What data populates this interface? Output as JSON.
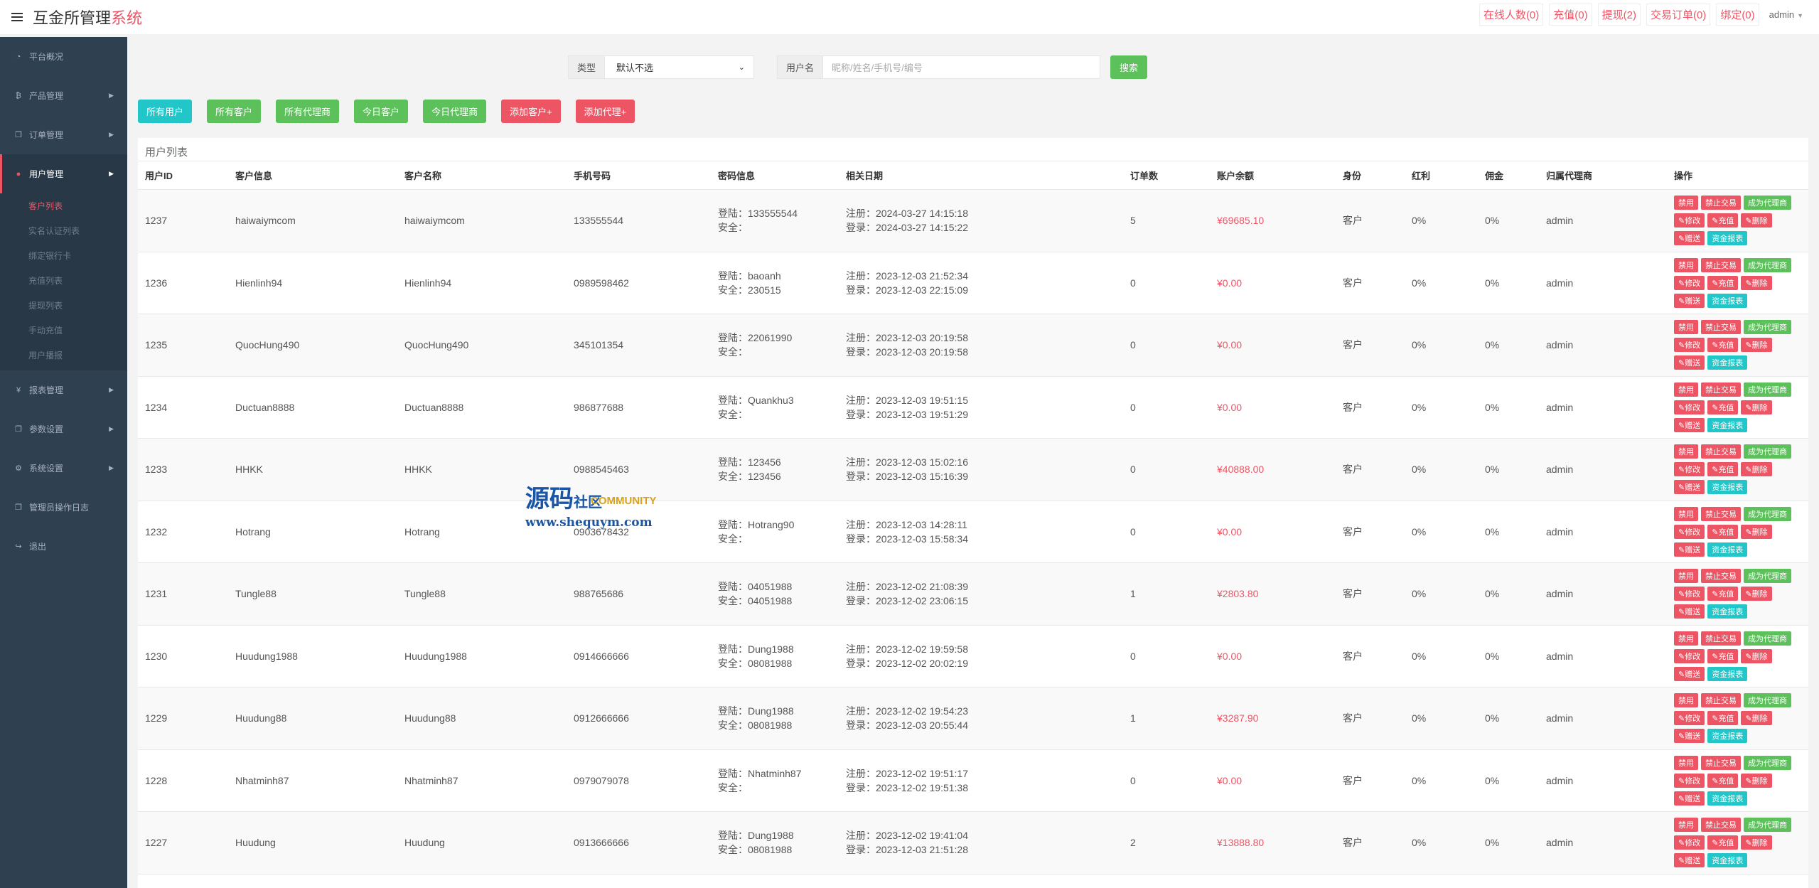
{
  "header": {
    "brand_main": "互金所管理",
    "brand_accent": "系统",
    "links": [
      "在线人数(0)",
      "充值(0)",
      "提现(2)",
      "交易订单(0)",
      "绑定(0)"
    ],
    "admin": "admin"
  },
  "sidebar": {
    "items": [
      {
        "label": "平台概况",
        "icon": "dashboard-icon",
        "arrow": false
      },
      {
        "label": "产品管理",
        "icon": "bitcoin-icon",
        "arrow": true
      },
      {
        "label": "订单管理",
        "icon": "copy-icon",
        "arrow": true
      },
      {
        "label": "用户管理",
        "icon": "user-icon",
        "arrow": true,
        "active": true
      },
      {
        "label": "报表管理",
        "icon": "yen-icon",
        "arrow": true
      },
      {
        "label": "参数设置",
        "icon": "copy-icon",
        "arrow": true
      },
      {
        "label": "系统设置",
        "icon": "gears-icon",
        "arrow": true
      },
      {
        "label": "管理员操作日志",
        "icon": "copy-icon",
        "arrow": false
      },
      {
        "label": "退出",
        "icon": "sign-out-icon",
        "arrow": false
      }
    ],
    "sub_items": [
      "客户列表",
      "实名认证列表",
      "绑定银行卡",
      "充值列表",
      "提现列表",
      "手动充值",
      "用户播报"
    ]
  },
  "search": {
    "type_label": "类型",
    "type_value": "默认不选",
    "user_label": "用户名",
    "user_placeholder": "昵称/姓名/手机号/编号",
    "button": "搜索"
  },
  "filters": [
    {
      "label": "所有用户",
      "color": "cyan"
    },
    {
      "label": "所有客户",
      "color": "green"
    },
    {
      "label": "所有代理商",
      "color": "green"
    },
    {
      "label": "今日客户",
      "color": "green"
    },
    {
      "label": "今日代理商",
      "color": "green"
    },
    {
      "label": "添加客户+",
      "color": "red"
    },
    {
      "label": "添加代理+",
      "color": "red"
    }
  ],
  "table": {
    "title": "用户列表",
    "headers": [
      "用户ID",
      "客户信息",
      "客户名称",
      "手机号码",
      "密码信息",
      "相关日期",
      "订单数",
      "账户余额",
      "身份",
      "红利",
      "佣金",
      "归属代理商",
      "操作"
    ],
    "actions": {
      "line1": [
        "禁用",
        "禁止交易",
        "成为代理商"
      ],
      "line2": [
        "修改",
        "充值",
        "删除"
      ],
      "line3": [
        "赠送",
        "资金报表"
      ]
    },
    "rows": [
      {
        "id": "1237",
        "info": "haiwaiymcom",
        "name": "haiwaiymcom",
        "phone": "133555544",
        "pw1": "登陆：133555544",
        "pw2": "安全：",
        "d1": "注册：2024-03-27 14:15:18",
        "d2": "登录：2024-03-27 14:15:22",
        "orders": "5",
        "balance": "¥69685.10",
        "role": "客户",
        "bonus": "0%",
        "comm": "0%",
        "agent": "admin"
      },
      {
        "id": "1236",
        "info": "Hienlinh94",
        "name": "Hienlinh94",
        "phone": "0989598462",
        "pw1": "登陆：baoanh",
        "pw2": "安全：230515",
        "d1": "注册：2023-12-03 21:52:34",
        "d2": "登录：2023-12-03 22:15:09",
        "orders": "0",
        "balance": "¥0.00",
        "role": "客户",
        "bonus": "0%",
        "comm": "0%",
        "agent": "admin"
      },
      {
        "id": "1235",
        "info": "QuocHung490",
        "name": "QuocHung490",
        "phone": "345101354",
        "pw1": "登陆：22061990",
        "pw2": "安全：",
        "d1": "注册：2023-12-03 20:19:58",
        "d2": "登录：2023-12-03 20:19:58",
        "orders": "0",
        "balance": "¥0.00",
        "role": "客户",
        "bonus": "0%",
        "comm": "0%",
        "agent": "admin"
      },
      {
        "id": "1234",
        "info": "Ductuan8888",
        "name": "Ductuan8888",
        "phone": "986877688",
        "pw1": "登陆：Quankhu3",
        "pw2": "安全：",
        "d1": "注册：2023-12-03 19:51:15",
        "d2": "登录：2023-12-03 19:51:29",
        "orders": "0",
        "balance": "¥0.00",
        "role": "客户",
        "bonus": "0%",
        "comm": "0%",
        "agent": "admin"
      },
      {
        "id": "1233",
        "info": "HHKK",
        "name": "HHKK",
        "phone": "0988545463",
        "pw1": "登陆：123456",
        "pw2": "安全：123456",
        "d1": "注册：2023-12-03 15:02:16",
        "d2": "登录：2023-12-03 15:16:39",
        "orders": "0",
        "balance": "¥40888.00",
        "role": "客户",
        "bonus": "0%",
        "comm": "0%",
        "agent": "admin"
      },
      {
        "id": "1232",
        "info": "Hotrang",
        "name": "Hotrang",
        "phone": "0903678432",
        "pw1": "登陆：Hotrang90",
        "pw2": "安全：",
        "d1": "注册：2023-12-03 14:28:11",
        "d2": "登录：2023-12-03 15:58:34",
        "orders": "0",
        "balance": "¥0.00",
        "role": "客户",
        "bonus": "0%",
        "comm": "0%",
        "agent": "admin"
      },
      {
        "id": "1231",
        "info": "Tungle88",
        "name": "Tungle88",
        "phone": "988765686",
        "pw1": "登陆：04051988",
        "pw2": "安全：04051988",
        "d1": "注册：2023-12-02 21:08:39",
        "d2": "登录：2023-12-02 23:06:15",
        "orders": "1",
        "balance": "¥2803.80",
        "role": "客户",
        "bonus": "0%",
        "comm": "0%",
        "agent": "admin"
      },
      {
        "id": "1230",
        "info": "Huudung1988",
        "name": "Huudung1988",
        "phone": "0914666666",
        "pw1": "登陆：Dung1988",
        "pw2": "安全：08081988",
        "d1": "注册：2023-12-02 19:59:58",
        "d2": "登录：2023-12-02 20:02:19",
        "orders": "0",
        "balance": "¥0.00",
        "role": "客户",
        "bonus": "0%",
        "comm": "0%",
        "agent": "admin"
      },
      {
        "id": "1229",
        "info": "Huudung88",
        "name": "Huudung88",
        "phone": "0912666666",
        "pw1": "登陆：Dung1988",
        "pw2": "安全：08081988",
        "d1": "注册：2023-12-02 19:54:23",
        "d2": "登录：2023-12-03 20:55:44",
        "orders": "1",
        "balance": "¥3287.90",
        "role": "客户",
        "bonus": "0%",
        "comm": "0%",
        "agent": "admin"
      },
      {
        "id": "1228",
        "info": "Nhatminh87",
        "name": "Nhatminh87",
        "phone": "0979079078",
        "pw1": "登陆：Nhatminh87",
        "pw2": "安全：",
        "d1": "注册：2023-12-02 19:51:17",
        "d2": "登录：2023-12-02 19:51:38",
        "orders": "0",
        "balance": "¥0.00",
        "role": "客户",
        "bonus": "0%",
        "comm": "0%",
        "agent": "admin"
      },
      {
        "id": "1227",
        "info": "Huudung",
        "name": "Huudung",
        "phone": "0913666666",
        "pw1": "登陆：Dung1988",
        "pw2": "安全：08081988",
        "d1": "注册：2023-12-02 19:41:04",
        "d2": "登录：2023-12-03 21:51:28",
        "orders": "2",
        "balance": "¥13888.80",
        "role": "客户",
        "bonus": "0%",
        "comm": "0%",
        "agent": "admin"
      }
    ]
  },
  "watermark": {
    "big": "源码",
    "mid": "社区",
    "community": "COMMUNITY",
    "url": "www.shequym.com"
  },
  "colors": {
    "accent": "#ed5565",
    "green": "#5cc05b",
    "cyan": "#23c6c8",
    "sidebar": "#2f4050"
  }
}
